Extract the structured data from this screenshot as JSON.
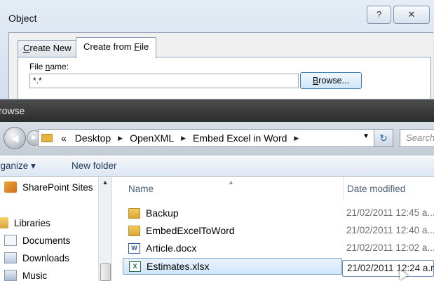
{
  "object_dialog": {
    "title": "Object",
    "help_label": "?",
    "close_label": "✕",
    "tabs": [
      {
        "label_pre": "",
        "label_accel": "C",
        "label_post": "reate New"
      },
      {
        "label_pre": "Create from ",
        "label_accel": "F",
        "label_post": "ile"
      }
    ],
    "file_name_label_pre": "File ",
    "file_name_label_accel": "n",
    "file_name_label_post": "ame:",
    "file_name_value": "*.*",
    "browse_label_accel": "B",
    "browse_label_post": "rowse..."
  },
  "browse": {
    "title": "rowse",
    "breadcrumb": {
      "overflow": "«",
      "items": [
        "Desktop",
        "OpenXML",
        "Embed Excel in Word"
      ]
    },
    "search_placeholder": "Search",
    "toolbar": {
      "organize": "rganize ▾",
      "new_folder": "New folder"
    },
    "nav_items": [
      {
        "label": "SharePoint Sites",
        "icon": "sharepoint-icon"
      },
      {
        "label": "Libraries",
        "icon": "libraries-icon"
      },
      {
        "label": "Documents",
        "icon": "documents-icon"
      },
      {
        "label": "Downloads",
        "icon": "downloads-icon"
      },
      {
        "label": "Music",
        "icon": "music-icon"
      }
    ],
    "columns": {
      "name": "Name",
      "date": "Date modified"
    },
    "files": [
      {
        "name": "Backup",
        "date": "21/02/2011 12:45 a...",
        "icon": "folder-icon"
      },
      {
        "name": "EmbedExcelToWord",
        "date": "21/02/2011 12:40 a...",
        "icon": "folder-icon"
      },
      {
        "name": "Article.docx",
        "date": "21/02/2011 12:02 a...",
        "icon": "word-file-icon"
      },
      {
        "name": "Estimates.xlsx",
        "date": "21/02/2011 12:24 a.m",
        "icon": "excel-file-icon"
      }
    ]
  }
}
